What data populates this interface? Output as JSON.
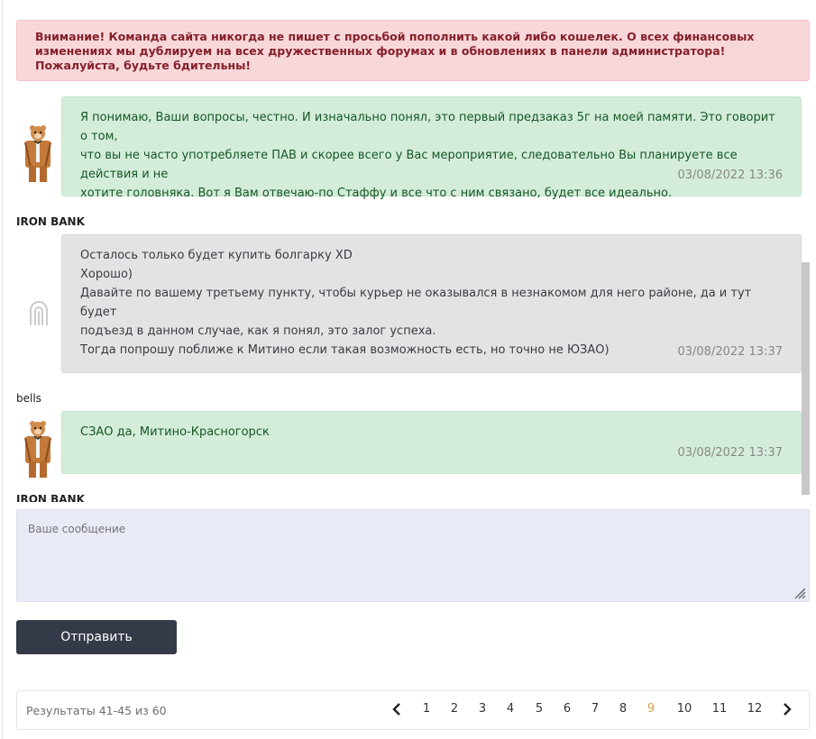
{
  "alert": {
    "text": "Внимание! Команда сайта никогда не пишет с просьбой пополнить какой либо кошелек. О всех финансовых изменениях мы дублируем на всех дружественных форумах и в обновлениях в панели администратора! Пожалуйста, будьте бдительны!"
  },
  "messages": [
    {
      "author": "",
      "avatar": "bear-in-suit-avatar",
      "lines": [
        "Я понимаю, Ваши вопросы, честно. И изначально понял, это первый предзаказ 5г на моей памяти. Это говорит о том,",
        "что вы не часто употребляете ПАВ и скорее всего у Вас мероприятие, следовательно Вы планируете все действия и не",
        "хотите головняка. Вот я Вам отвечаю-по Стаффу и все что с ним связано, будет все идеально."
      ],
      "time": "03/08/2022 13:36"
    },
    {
      "author": "IRON BANK",
      "avatar": "fingerprint-avatar",
      "lines": [
        "Осталось только будет купить болгарку XD",
        "Хорошо)",
        "Давайте по вашему третьему пункту, чтобы курьер не оказывался в незнакомом для него районе, да и тут будет",
        "подъезд в данном случае, как я понял, это залог успеха.",
        "Тогда попрошу поближе к Митино если такая возможность есть, но точно не ЮЗАО)"
      ],
      "time": "03/08/2022 13:37"
    },
    {
      "author": "bells",
      "avatar": "bear-in-suit-avatar",
      "lines": [
        "СЗАО да, Митино-Красногорск"
      ],
      "time": "03/08/2022 13:37"
    },
    {
      "author": "IRON BANK"
    }
  ],
  "composer": {
    "placeholder": "Ваше сообщение",
    "send_label": "Отправить"
  },
  "pagination": {
    "results_text": "Результаты 41-45 из 60",
    "pages": [
      "1",
      "2",
      "3",
      "4",
      "5",
      "6",
      "7",
      "8",
      "9",
      "10",
      "11",
      "12"
    ],
    "current": "9",
    "prev_icon": "chevron-left-icon",
    "next_icon": "chevron-right-icon"
  },
  "colors": {
    "alert_bg": "#f8d7da",
    "alert_text": "#842029",
    "own_bubble_bg": "#d4edda",
    "own_bubble_text": "#155724",
    "other_bubble_bg": "#e2e3e5",
    "send_button_bg": "#343a48",
    "current_page": "#d9a14a"
  }
}
